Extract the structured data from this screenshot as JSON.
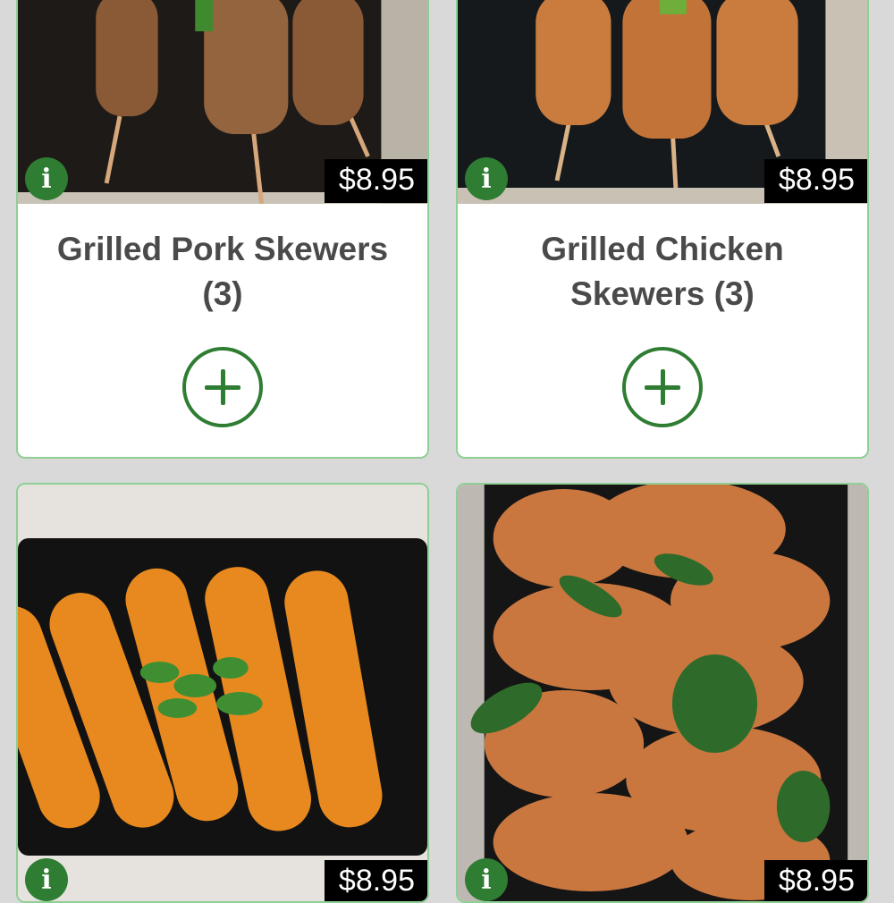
{
  "menu_items": [
    {
      "name": "Grilled Pork Skewers (3)",
      "price": "$8.95",
      "info_icon": "info-icon",
      "add_icon": "plus-icon"
    },
    {
      "name": "Grilled Chicken Skewers (3)",
      "price": "$8.95",
      "info_icon": "info-icon",
      "add_icon": "plus-icon"
    },
    {
      "price": "$8.95",
      "info_icon": "info-icon"
    },
    {
      "price": "$8.95",
      "info_icon": "info-icon"
    }
  ],
  "colors": {
    "accent_green": "#2e7d32",
    "card_border": "#8fcf95",
    "page_background": "#d9d9d9",
    "price_tag_bg": "#000000"
  }
}
